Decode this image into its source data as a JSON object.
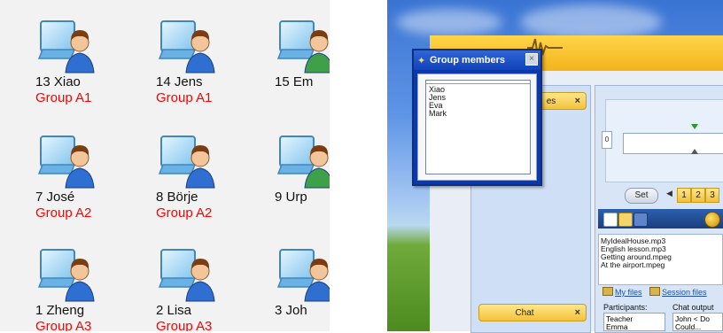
{
  "students": [
    {
      "name": "13 Xiao",
      "group": "Group A1",
      "color": "blue"
    },
    {
      "name": "14 Jens",
      "group": "Group A1",
      "color": "blue"
    },
    {
      "name": "15 Em",
      "group": "",
      "color": "green"
    },
    {
      "name": "7 José",
      "group": "Group A2",
      "color": "blue"
    },
    {
      "name": "8 Börje",
      "group": "Group A2",
      "color": "blue"
    },
    {
      "name": "9 Urp",
      "group": "",
      "color": "green"
    },
    {
      "name": "1 Zheng",
      "group": "Group A3",
      "color": "blue"
    },
    {
      "name": "2 Lisa",
      "group": "Group A3",
      "color": "blue"
    },
    {
      "name": "3 Joh",
      "group": "",
      "color": "blue"
    }
  ],
  "colors": {
    "group_label": "#ff0000",
    "dialog_title_bg": "#1141b8"
  },
  "dialog": {
    "title": "Group members",
    "close_icon": "×",
    "members": [
      "Xiao",
      "Jens",
      "Eva",
      "Mark"
    ]
  },
  "app": {
    "sidebar_tab_top": {
      "label": "es",
      "close": "×"
    },
    "sidebar_tab_bottom": {
      "label": "Chat",
      "close": "×"
    },
    "set_label": "Set",
    "pages": [
      "1",
      "2",
      "3"
    ],
    "left_handle": "0",
    "files": [
      "MyIdealHouse.mp3",
      "English lesson.mp3",
      "Getting around.mpeg",
      "At the airport.mpeg"
    ],
    "tab_my_files": "My files",
    "tab_session_files": "Session files",
    "participants_label": "Participants:",
    "chat_output_label": "Chat output",
    "participants": [
      "Teacher",
      "Emma"
    ],
    "chat_lines": [
      "John < Do",
      "Could..."
    ]
  }
}
